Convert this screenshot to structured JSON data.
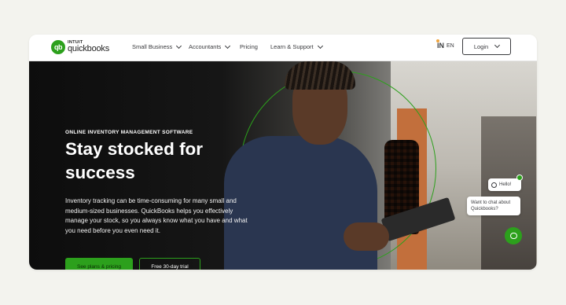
{
  "header": {
    "logo": {
      "brand_top": "INTUIT",
      "brand_main": "quickbooks",
      "mark": "qb"
    },
    "nav": [
      {
        "label": "Small Business",
        "has_dropdown": true
      },
      {
        "label": "Accountants",
        "has_dropdown": true
      },
      {
        "label": "Pricing",
        "has_dropdown": false
      },
      {
        "label": "Learn & Support",
        "has_dropdown": true
      }
    ],
    "lang": {
      "flag_text": "IN",
      "code": "EN"
    },
    "login_label": "Login"
  },
  "hero": {
    "eyebrow": "ONLINE INVENTORY MANAGEMENT SOFTWARE",
    "headline": "Stay stocked  for\nsuccess",
    "body": "Inventory tracking can be time-consuming for many small and medium-sized businesses. QuickBooks helps you effectively manage your stock, so you always know what you have and what you need before you even need it.",
    "primary_cta": "See plans & pricing",
    "secondary_cta": "Free 30-day trial"
  },
  "chat": {
    "hello": "Hello!",
    "prompt": "Want to chat about Quickbooks?"
  },
  "colors": {
    "accent": "#2ca01c",
    "text_dark": "#393a3d",
    "page_bg": "#f3f3ee"
  }
}
